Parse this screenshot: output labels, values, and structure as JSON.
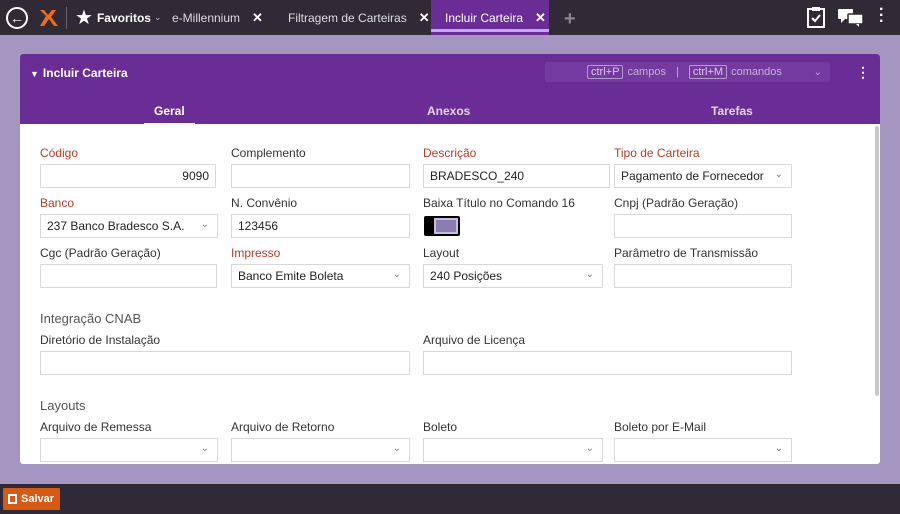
{
  "topbar": {
    "favorites_label": "Favoritos",
    "tabs": [
      {
        "label": "e-Millennium"
      },
      {
        "label": "Filtragem de Carteiras"
      },
      {
        "label": "Incluir Carteira"
      }
    ]
  },
  "panel": {
    "title": "Incluir Carteira",
    "cmd": {
      "key1": "ctrl+P",
      "text1": "campos",
      "separator": "|",
      "key2": "ctrl+M",
      "text2": "comandos"
    },
    "subtabs": [
      "Geral",
      "Anexos",
      "Tarefas"
    ]
  },
  "form": {
    "codigo": {
      "label": "Código",
      "value": "9090"
    },
    "complemento": {
      "label": "Complemento",
      "value": ""
    },
    "descricao": {
      "label": "Descrição",
      "value": "BRADESCO_240"
    },
    "tipo_carteira": {
      "label": "Tipo de Carteira",
      "value": "Pagamento de Fornecedor"
    },
    "banco": {
      "label": "Banco",
      "value": "237 Banco Bradesco S.A."
    },
    "convenio": {
      "label": "N. Convênio",
      "value": "123456"
    },
    "baixa_titulo": {
      "label": "Baixa Título no Comando 16",
      "checked": true
    },
    "cnpj": {
      "label": "Cnpj (Padrão Geração)",
      "value": ""
    },
    "cgc": {
      "label": "Cgc (Padrão Geração)",
      "value": ""
    },
    "impresso": {
      "label": "Impresso",
      "value": "Banco Emite Boleta"
    },
    "layout": {
      "label": "Layout",
      "value": "240 Posições"
    },
    "parametro": {
      "label": "Parâmetro de Transmissão",
      "value": ""
    },
    "integracao_title": "Integração CNAB",
    "diretorio": {
      "label": "Diretório de Instalação",
      "value": ""
    },
    "licenca": {
      "label": "Arquivo de Licença",
      "value": ""
    },
    "layouts_title": "Layouts",
    "remessa": {
      "label": "Arquivo de Remessa",
      "value": ""
    },
    "retorno": {
      "label": "Arquivo de Retorno",
      "value": ""
    },
    "boleto": {
      "label": "Boleto",
      "value": ""
    },
    "boleto_email": {
      "label": "Boleto por E-Mail",
      "value": ""
    }
  },
  "footer": {
    "save_label": "Salvar"
  },
  "colors": {
    "accent": "#6a2d95",
    "required": "#b13e2a",
    "save": "#d55a14"
  }
}
